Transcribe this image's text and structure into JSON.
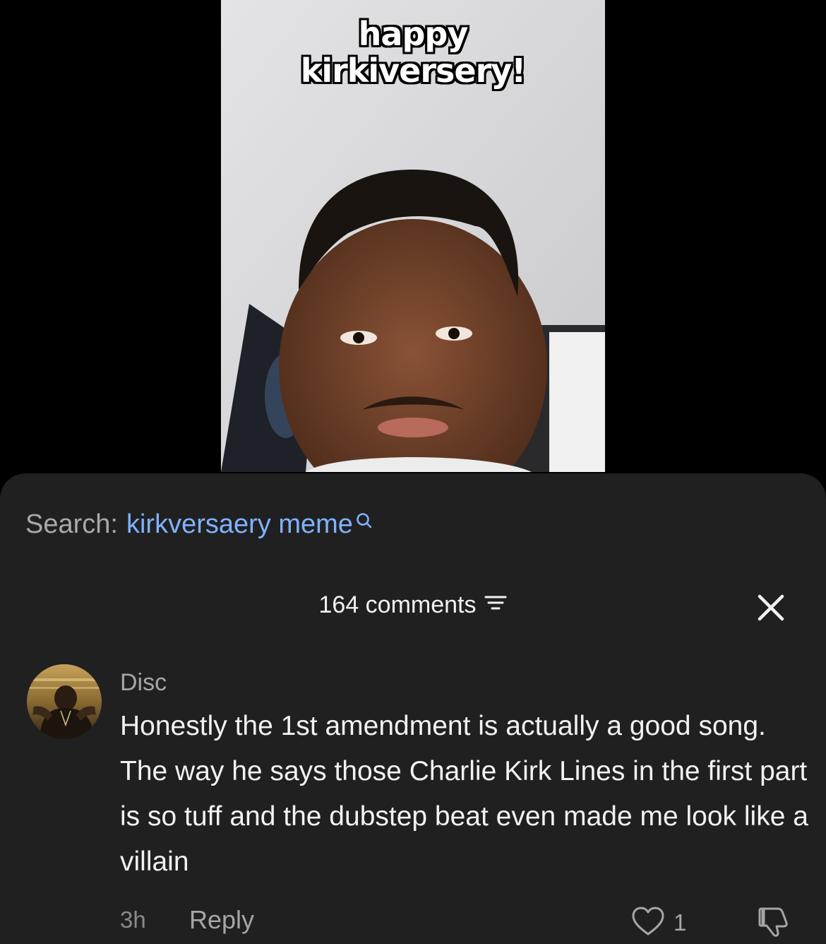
{
  "video": {
    "caption_line1": "happy",
    "caption_line2": "kirkiversery!"
  },
  "search": {
    "prefix": "Search:",
    "query": "kirkversaery meme",
    "icon": "search-icon"
  },
  "comments": {
    "count_label": "164 comments",
    "sort_icon": "sort-icon",
    "close_icon": "close-icon"
  },
  "comment": {
    "username": "Disc",
    "text": "Honestly the 1st amendment is actually a good song. The way he says those Charlie Kirk Lines in the first part is so tuff and the dubstep beat even made me look like a villain",
    "time": "3h",
    "reply_label": "Reply",
    "likes": "1",
    "like_icon": "heart-outline-icon",
    "dislike_icon": "thumbs-down-icon"
  },
  "colors": {
    "background": "#000000",
    "panel": "#202020",
    "link_blue": "#7fb2ff",
    "muted_text": "#a6a6a6",
    "primary_text": "#f2f2f2"
  }
}
